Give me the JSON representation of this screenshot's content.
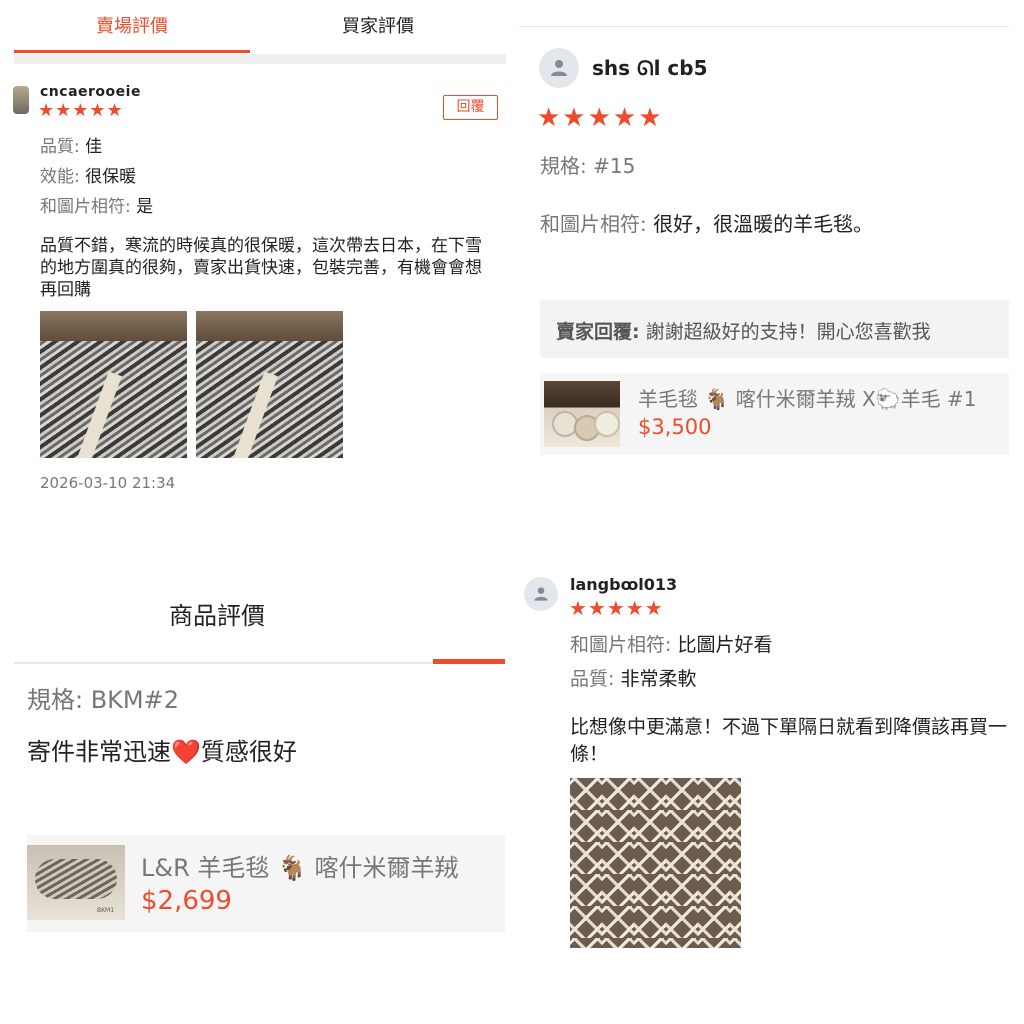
{
  "panel1": {
    "tabs": [
      {
        "label": "賣場評價",
        "active": true
      },
      {
        "label": "買家評價",
        "active": false
      }
    ],
    "username": "cncaerooeie",
    "stars": "★★★★★",
    "reply_button": "回覆",
    "attributes": [
      {
        "label": "品質",
        "value": "佳"
      },
      {
        "label": "效能",
        "value": "很保暖"
      },
      {
        "label": "和圖片相符",
        "value": "是"
      }
    ],
    "comment": "品質不錯，寒流的時候真的很保暖，這次帶去日本，在下雪的地方圍真的很夠，賣家出貨快速，包裝完善，有機會會想再回購",
    "timestamp": "2026-03-10 21:34"
  },
  "panel2": {
    "username": "shs ᘏl cb5",
    "stars": "★★★★★",
    "spec": "規格: #15",
    "match_label": "和圖片相符:",
    "match_value": "很好，很溫暖的羊毛毯。",
    "seller_reply_label": "賣家回覆:",
    "seller_reply_text": "謝謝超級好的支持！開心您喜歡我",
    "product_title": "羊毛毯 🐐 喀什米爾羊羢 X🐑羊毛 #1",
    "product_price": "$3,500"
  },
  "panel3": {
    "header": "商品評價",
    "spec": "規格: BKM#2",
    "comment": "寄件非常迅速❤️質感很好",
    "product_title": "L&R 羊毛毯 🐐 喀什米爾羊羢",
    "product_price": "$2,699",
    "thumb_caption": "BKM1"
  },
  "panel4": {
    "username": "langbꝏl013",
    "stars": "★★★★★",
    "attributes": [
      {
        "label": "和圖片相符",
        "value": "比圖片好看"
      },
      {
        "label": "品質",
        "value": "非常柔軟"
      }
    ],
    "comment": "比想像中更滿意！不過下單隔日就看到降價該再買一條！"
  },
  "colors": {
    "accent": "#ee4d2d",
    "muted_text": "#777777",
    "reply_bg": "#f3f3f3",
    "product_bg": "#f5f5f5"
  }
}
